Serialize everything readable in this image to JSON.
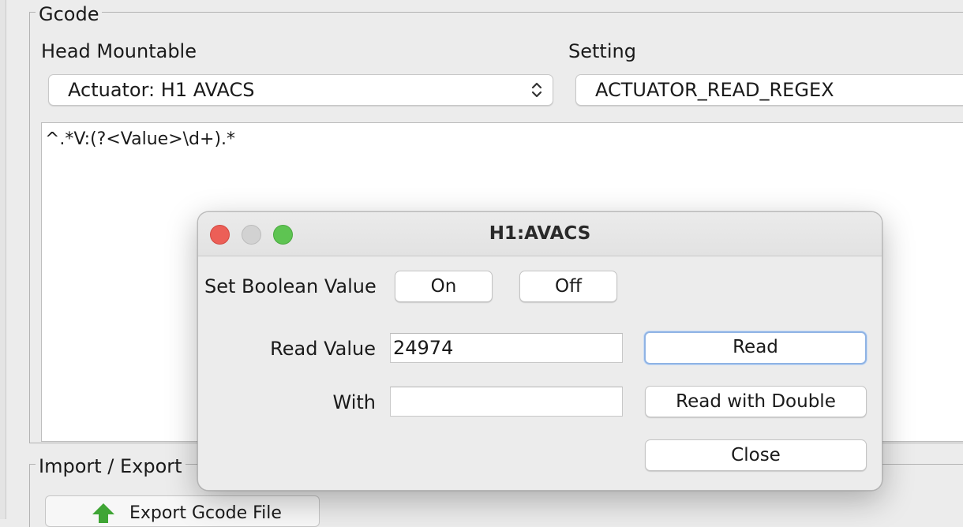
{
  "gcode_group": {
    "title": "Gcode",
    "head_mountable": {
      "label": "Head Mountable",
      "selected": "Actuator: H1 AVACS"
    },
    "setting": {
      "label": "Setting",
      "selected": "ACTUATOR_READ_REGEX"
    },
    "regex_text": "^.*V:(?<Value>\\d+).*"
  },
  "import_export_group": {
    "title": "Import / Export",
    "export_button_label": "Export Gcode File",
    "export_icon": "green-up-arrow-icon"
  },
  "dialog": {
    "title": "H1:AVACS",
    "set_boolean_label": "Set Boolean Value",
    "on_label": "On",
    "off_label": "Off",
    "read_value_label": "Read Value",
    "read_value": "24974",
    "read_button_label": "Read",
    "with_label": "With",
    "with_value": "",
    "read_with_double_label": "Read with Double",
    "close_label": "Close"
  },
  "colors": {
    "close_traffic": "#ec5f57",
    "minimize_traffic": "#d2d2d2",
    "maximize_traffic": "#5ec452",
    "focus_ring": "#8fb3e4",
    "export_arrow": "#3fa535"
  }
}
